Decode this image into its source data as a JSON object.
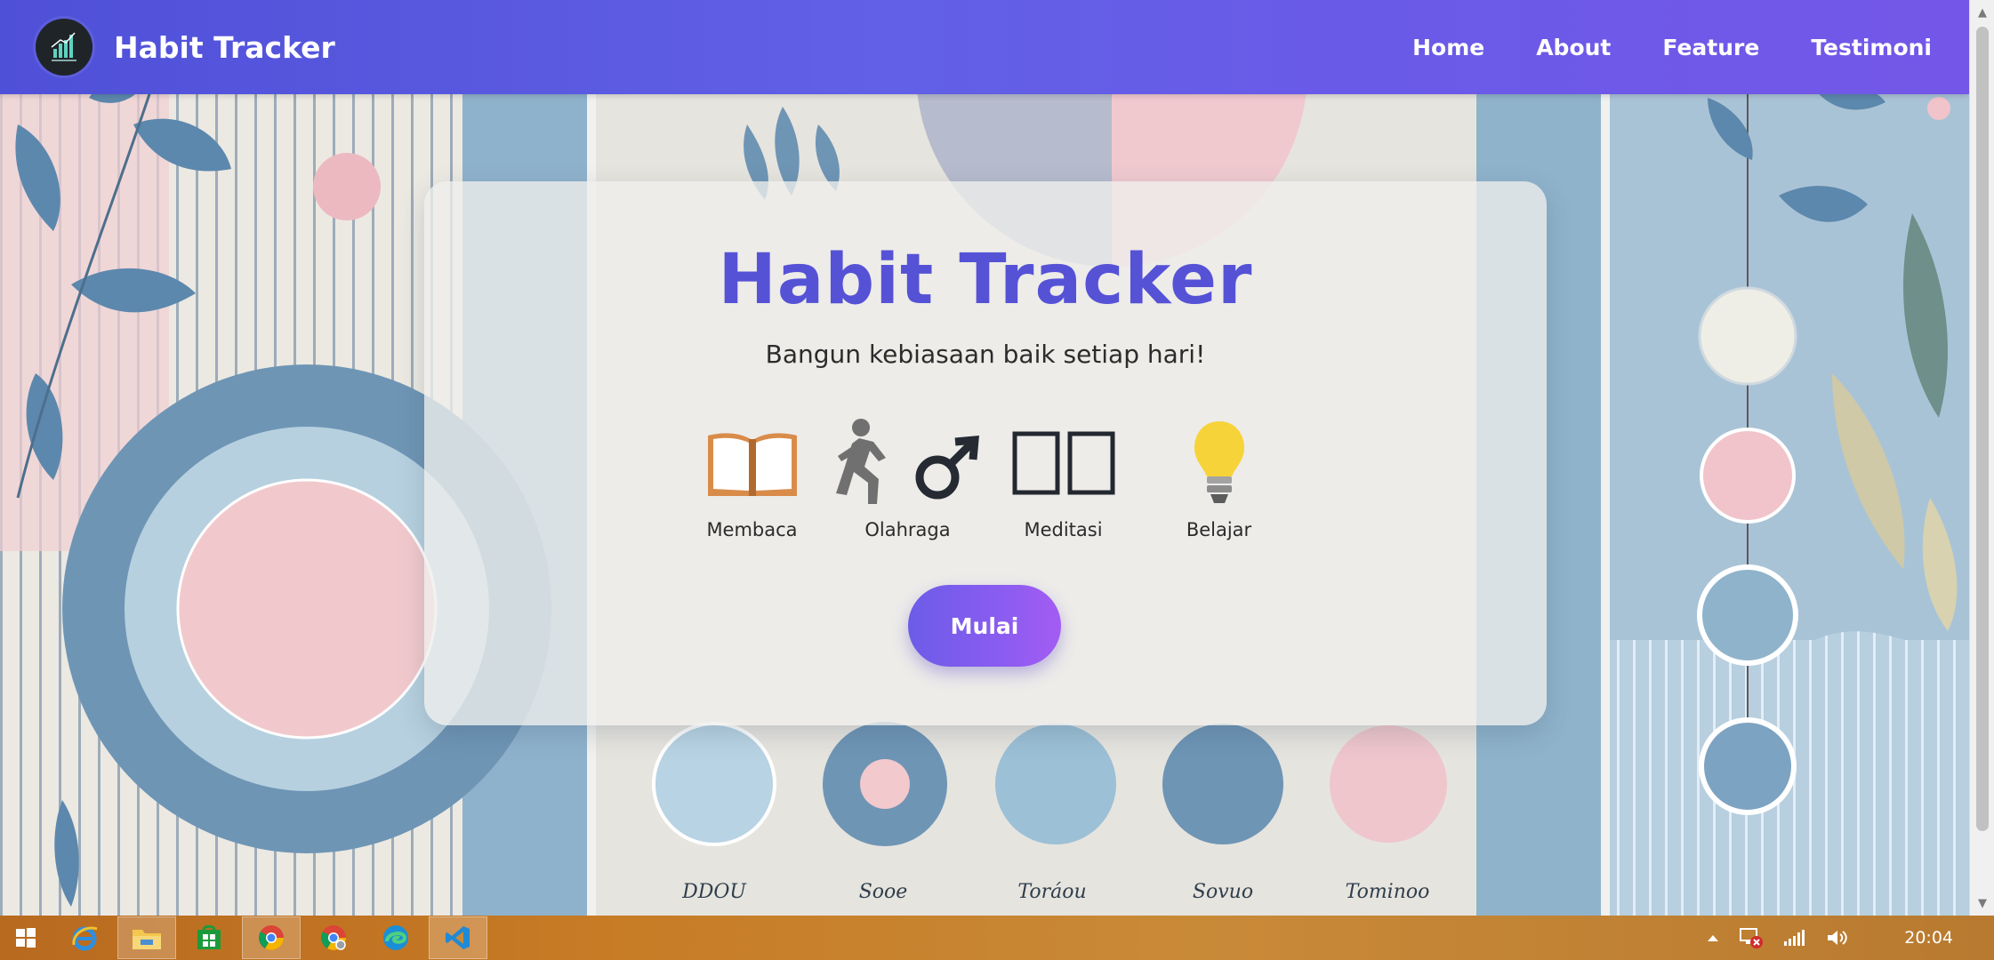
{
  "navbar": {
    "brand": "Habit Tracker",
    "links": [
      "Home",
      "About",
      "Feature",
      "Testimoni"
    ]
  },
  "hero": {
    "title": "Habit Tracker",
    "subtitle": "Bangun kebiasaan baik setiap hari!",
    "habits": [
      {
        "label": "Membaca",
        "icon": "book-icon"
      },
      {
        "label": "Olahraga",
        "icon": "runner-icon"
      },
      {
        "label": "Meditasi",
        "icon": "meditation-icon"
      },
      {
        "label": "Belajar",
        "icon": "lightbulb-icon"
      }
    ],
    "button": "Mulai"
  },
  "background": {
    "circle_labels": [
      "DDOU",
      "Sooe",
      "Toráou",
      "Sovuo",
      "Tominoo"
    ]
  },
  "taskbar": {
    "clock": "20:04",
    "apps": [
      "windows-start-icon",
      "internet-explorer-icon",
      "file-explorer-icon",
      "store-icon",
      "chrome-icon",
      "chrome-alt-icon",
      "edge-icon",
      "vscode-icon"
    ]
  },
  "colors": {
    "navbar": "#5e5de3",
    "title": "#5652d6",
    "button": "#8a5cf0",
    "taskbar": "#c77b25"
  }
}
